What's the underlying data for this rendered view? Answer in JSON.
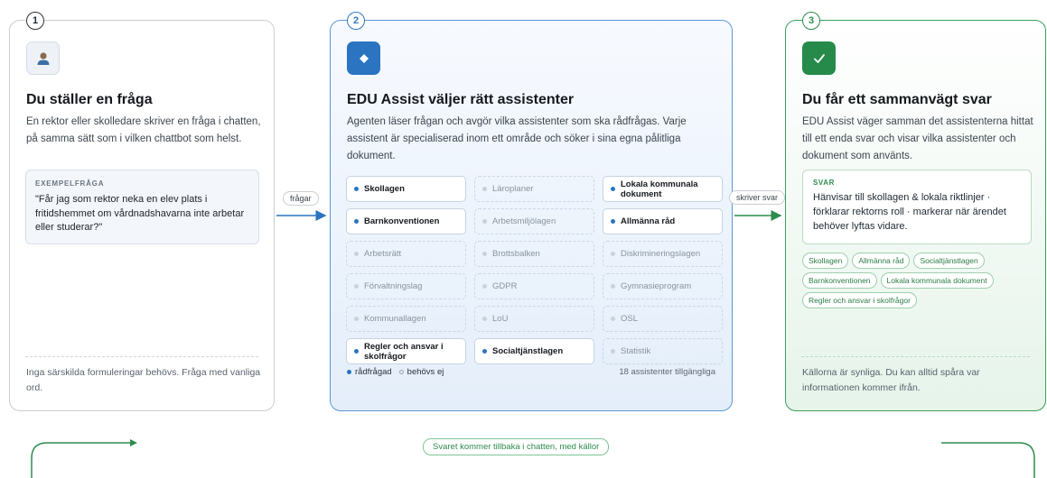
{
  "steps": [
    {
      "number": "1",
      "icon": "person-icon",
      "title": "Du ställer en fråga",
      "description": "En rektor eller skolledare skriver en fråga i chatten, på samma sätt som i vilken chattbot som helst.",
      "example_label": "EXEMPELFRÅGA",
      "example_text": "\"Får jag som rektor neka en elev plats i fritidshemmet om vårdnadshavarna inte arbetar eller studerar?\"",
      "footer": "Inga särskilda formuleringar behövs. Fråga med vanliga ord."
    },
    {
      "number": "2",
      "icon": "diamond-icon",
      "title": "EDU Assist väljer rätt assistenter",
      "description": "Agenten läser frågan och avgör vilka assistenter som ska rådfrågas. Varje assistent är specialiserad inom ett område och söker i sina egna pålitliga dokument.",
      "assistants": [
        {
          "label": "Skollagen",
          "consulted": true
        },
        {
          "label": "Läroplaner",
          "consulted": false
        },
        {
          "label": "Lokala kommunala dokument",
          "consulted": true
        },
        {
          "label": "Barnkonventionen",
          "consulted": true
        },
        {
          "label": "Arbetsmiljölagen",
          "consulted": false
        },
        {
          "label": "Allmänna råd",
          "consulted": true
        },
        {
          "label": "Arbetsrätt",
          "consulted": false
        },
        {
          "label": "Brottsbalken",
          "consulted": false
        },
        {
          "label": "Diskrimineringslagen",
          "consulted": false
        },
        {
          "label": "Förvaltningslag",
          "consulted": false
        },
        {
          "label": "GDPR",
          "consulted": false
        },
        {
          "label": "Gymnasieprogram",
          "consulted": false
        },
        {
          "label": "Kommunallagen",
          "consulted": false
        },
        {
          "label": "LoU",
          "consulted": false
        },
        {
          "label": "OSL",
          "consulted": false
        },
        {
          "label": "Regler och ansvar i skolfrågor",
          "consulted": true
        },
        {
          "label": "Socialtjänstlagen",
          "consulted": true
        },
        {
          "label": "Statistik",
          "consulted": false
        }
      ],
      "legend_consulted": "rådfrågad",
      "legend_not_needed": "behövs ej",
      "available_count": "18 assistenter tillgängliga"
    },
    {
      "number": "3",
      "icon": "check-icon",
      "title": "Du får ett sammanvägt svar",
      "description": "EDU Assist väger samman det assistenterna hittat till ett enda svar och visar vilka assistenter och dokument som använts.",
      "answer_label": "SVAR",
      "answer_text": "Hänvisar till skollagen & lokala riktlinjer · förklarar rektorns roll · markerar när ärendet behöver lyftas vidare.",
      "sources": [
        "Skollagen",
        "Allmänna råd",
        "Socialtjänstlagen",
        "Barnkonventionen",
        "Lokala kommunala dokument",
        "Regler och ansvar i skolfrågor"
      ],
      "footer": "Källorna är synliga. Du kan alltid spåra var informationen kommer ifrån."
    }
  ],
  "connectors": {
    "step1_to_2": "frågar",
    "step2_to_3": "skriver svar",
    "back_to_chat": "Svaret kommer tillbaka i chatten, med källor"
  },
  "colors": {
    "blue_accent": "#2a74c1",
    "green_accent": "#2e8b4e",
    "neutral_border": "#c9cdd2"
  }
}
